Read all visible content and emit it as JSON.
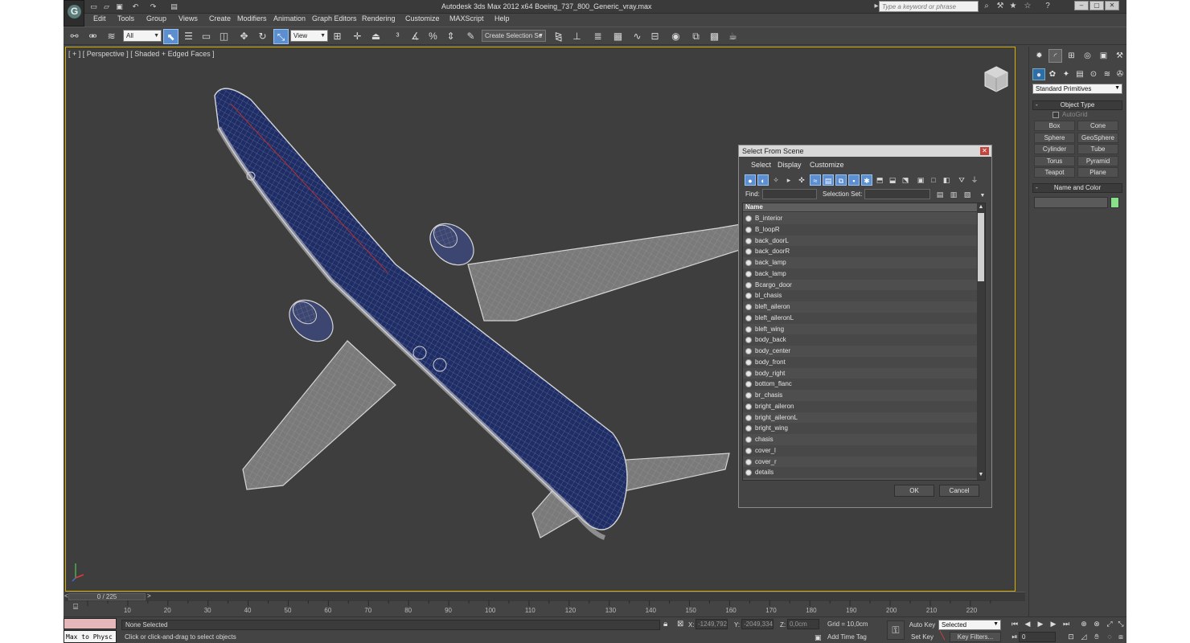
{
  "title_bar": {
    "window_title": "Autodesk 3ds Max  2012 x64      Boeing_737_800_Generic_vray.max",
    "search_placeholder": "Type a keyword or phrase"
  },
  "menu": [
    "Edit",
    "Tools",
    "Group",
    "Views",
    "Create",
    "Modifiers",
    "Animation",
    "Graph Editors",
    "Rendering",
    "Customize",
    "MAXScript",
    "Help"
  ],
  "toolbar": {
    "selection_filter": "All",
    "ref_coord": "View",
    "named_selection_placeholder": "Create Selection Se"
  },
  "viewport": {
    "label": "[ + ] [ Perspective ] [ Shaded + Edged Faces ]",
    "wire_color": "#cfcfcf",
    "fuselage_color": "#1f2d66",
    "border_color": "#d8b000"
  },
  "command_panel": {
    "category": "Standard Primitives",
    "object_type_title": "Object Type",
    "autogrid_label": "AutoGrid",
    "primitives": [
      "Box",
      "Cone",
      "Sphere",
      "GeoSphere",
      "Cylinder",
      "Tube",
      "Torus",
      "Pyramid",
      "Teapot",
      "Plane"
    ],
    "name_color_title": "Name and Color",
    "swatch_color": "#88e08a"
  },
  "dialog": {
    "title": "Select From Scene",
    "menus": [
      "Select",
      "Display",
      "Customize"
    ],
    "find_label": "Find:",
    "selection_set_label": "Selection Set:",
    "column_header": "Name",
    "items": [
      "B_interior",
      "B_loopR",
      "back_doorL",
      "back_doorR",
      "back_lamp",
      "back_lamp",
      "Bcargo_door",
      "bl_chasis",
      "bleft_aileron",
      "bleft_aileronL",
      "bleft_wing",
      "body_back",
      "body_center",
      "body_front",
      "body_right",
      "bottom_flanc",
      "br_chasis",
      "bright_aileron",
      "bright_aileronL",
      "bright_wing",
      "chasis",
      "cover_l",
      "cover_r",
      "details"
    ],
    "ok_label": "OK",
    "cancel_label": "Cancel"
  },
  "timeline": {
    "frame_label": "0 / 225",
    "ticks": [
      "10",
      "20",
      "30",
      "40",
      "50",
      "60",
      "70",
      "80",
      "90",
      "100",
      "110",
      "120",
      "130",
      "140",
      "150",
      "160",
      "170",
      "180",
      "190",
      "200",
      "210",
      "220"
    ]
  },
  "status": {
    "maxscript_label": "Max to Physc",
    "selection_text": "None Selected",
    "prompt_text": "Click or click-and-drag to select objects",
    "x_label": "X:",
    "x_value": "-1249,792",
    "y_label": "Y:",
    "y_value": "-2049,334",
    "z_label": "Z:",
    "z_value": "0,0cm",
    "grid_text": "Grid = 10,0cm",
    "add_time_tag": "Add Time Tag",
    "auto_key_label": "Auto Key",
    "set_key_label": "Set Key",
    "key_mode_value": "Selected",
    "key_filters_label": "Key Filters...",
    "frame_value": "0"
  }
}
